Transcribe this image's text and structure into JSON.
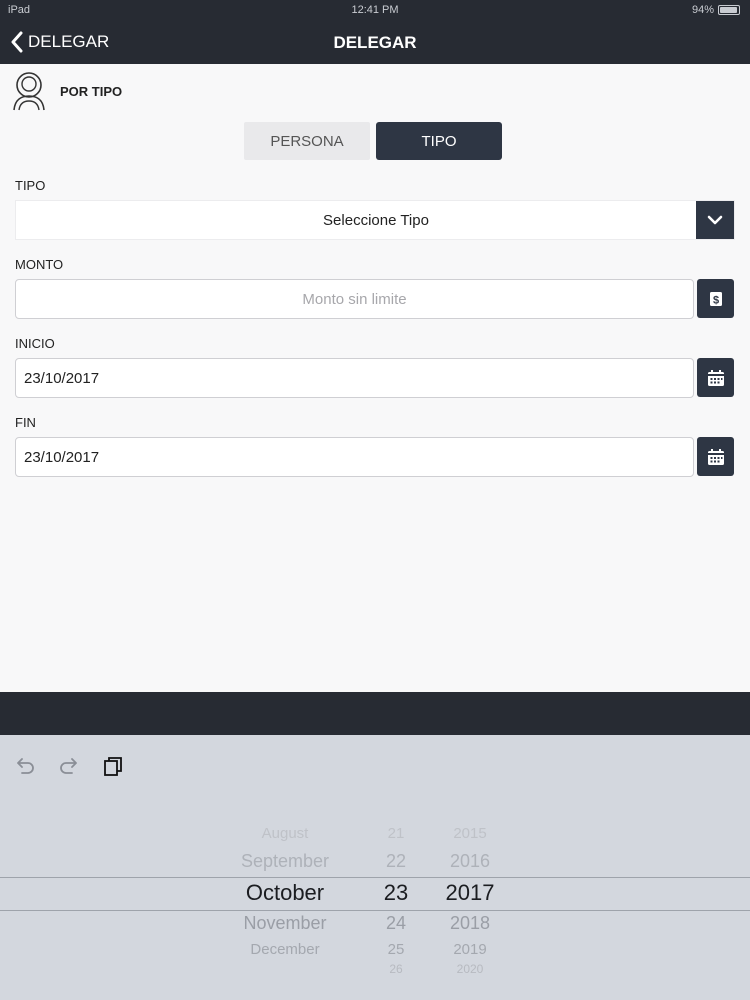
{
  "status_bar": {
    "device": "iPad",
    "time": "12:41 PM",
    "battery": "94%",
    "battery_level": 0.94
  },
  "nav": {
    "back_label": "DELEGAR",
    "title": "DELEGAR"
  },
  "section": {
    "title": "POR TIPO",
    "icon": "user-outline-icon"
  },
  "segmented": {
    "options": [
      "PERSONA",
      "TIPO"
    ],
    "selected": "TIPO"
  },
  "form": {
    "tipo": {
      "label": "TIPO",
      "value": "Seleccione Tipo",
      "icon": "chevron-down-icon"
    },
    "monto": {
      "label": "MONTO",
      "placeholder": "Monto sin limite",
      "icon": "dollar-icon"
    },
    "inicio": {
      "label": "INICIO",
      "value": "23/10/2017",
      "icon": "calendar-icon"
    },
    "fin": {
      "label": "FIN",
      "value": "23/10/2017",
      "icon": "calendar-icon"
    }
  },
  "toolbar": {
    "icons": [
      "undo-icon",
      "redo-icon",
      "paste-icon"
    ]
  },
  "picker": {
    "months": [
      "August",
      "September",
      "October",
      "November",
      "December"
    ],
    "days": [
      "21",
      "22",
      "23",
      "24",
      "25",
      "26"
    ],
    "years": [
      "2015",
      "2016",
      "2017",
      "2018",
      "2019",
      "2020"
    ],
    "selected": {
      "month": "October",
      "day": "23",
      "year": "2017"
    }
  },
  "colors": {
    "nav_bg": "#272b33",
    "accent_dark": "#2e3644",
    "page_bg": "#f8f8f9",
    "picker_bg": "#d3d7de"
  }
}
